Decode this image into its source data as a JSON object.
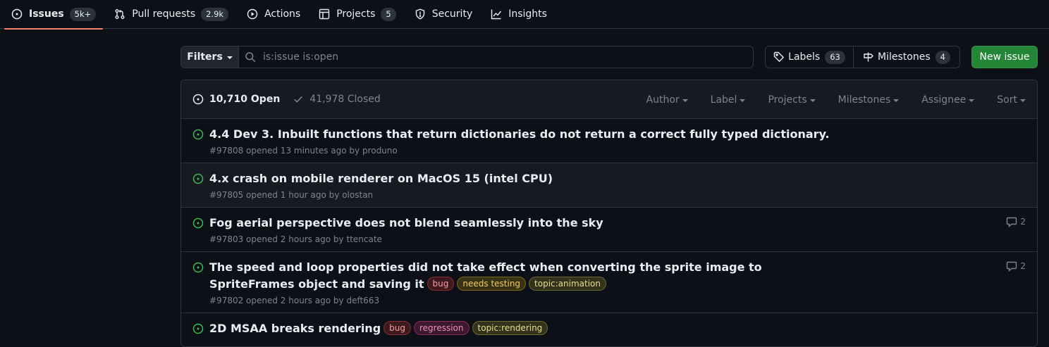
{
  "nav": {
    "tabs": [
      {
        "label": "Issues",
        "count": "5k+",
        "icon": "issue-opened-icon"
      },
      {
        "label": "Pull requests",
        "count": "2.9k",
        "icon": "git-pull-request-icon"
      },
      {
        "label": "Actions",
        "icon": "play-icon"
      },
      {
        "label": "Projects",
        "count": "5",
        "icon": "table-icon"
      },
      {
        "label": "Security",
        "icon": "shield-icon"
      },
      {
        "label": "Insights",
        "icon": "graph-icon"
      }
    ],
    "selected": "Issues"
  },
  "subnav": {
    "filters_label": "Filters",
    "search_value": "is:issue is:open",
    "labels_label": "Labels",
    "labels_count": "63",
    "milestones_label": "Milestones",
    "milestones_count": "4",
    "new_issue_label": "New issue"
  },
  "box_header": {
    "open_label": "10,710 Open",
    "closed_label": "41,978 Closed",
    "menus": [
      "Author",
      "Label",
      "Projects",
      "Milestones",
      "Assignee",
      "Sort"
    ]
  },
  "issues": [
    {
      "title": "4.4 Dev 3. Inbuilt functions that return dictionaries do not return a correct fully typed dictionary.",
      "meta": "#97808 opened 13 minutes ago by produno",
      "labels": [],
      "comments": ""
    },
    {
      "title": "4.x crash on mobile renderer on MacOS 15 (intel CPU)",
      "meta": "#97805 opened 1 hour ago by olostan",
      "labels": [],
      "comments": ""
    },
    {
      "title": "Fog aerial perspective does not blend seamlessly into the sky",
      "meta": "#97803 opened 2 hours ago by ttencate",
      "labels": [],
      "comments": "2"
    },
    {
      "title": "The speed and loop properties did not take effect when converting the sprite image to SpriteFrames object and saving it",
      "meta": "#97802 opened 2 hours ago by deft663",
      "labels": [
        {
          "name": "bug",
          "bg": "#3d1a1e",
          "border": "#8b2c33",
          "color": "#ff9aa0"
        },
        {
          "name": "needs testing",
          "bg": "#3a3214",
          "border": "#7a6a1e",
          "color": "#f2cc60"
        },
        {
          "name": "topic:animation",
          "bg": "#33321c",
          "border": "#6e6a2c",
          "color": "#e6de8a"
        }
      ],
      "comments": "2"
    },
    {
      "title": "2D MSAA breaks rendering",
      "meta": "",
      "labels": [
        {
          "name": "bug",
          "bg": "#3d1a1e",
          "border": "#8b2c33",
          "color": "#ff9aa0"
        },
        {
          "name": "regression",
          "bg": "#3b1a2e",
          "border": "#8a2a62",
          "color": "#f28bc4"
        },
        {
          "name": "topic:rendering",
          "bg": "#33321c",
          "border": "#6e6a2c",
          "color": "#e6de8a"
        }
      ],
      "comments": ""
    }
  ],
  "colors": {
    "accent_underline": "#f78166",
    "open_icon": "#3fb950",
    "new_issue_bg": "#238636"
  }
}
